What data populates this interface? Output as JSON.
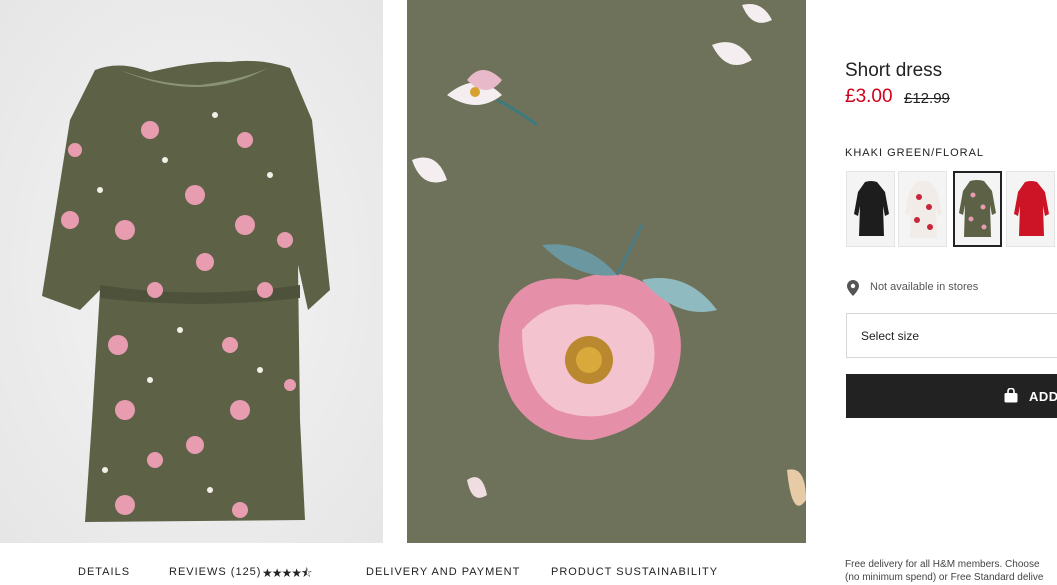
{
  "product": {
    "title": "Short dress",
    "price_now": "£3.00",
    "price_old": "£12.99",
    "color_name": "KHAKI GREEN/FLORAL"
  },
  "swatches": [
    {
      "name": "black",
      "color": "#1d1d1d",
      "selected": false
    },
    {
      "name": "white-floral",
      "color": "#f2ece8",
      "selected": false
    },
    {
      "name": "khaki-floral",
      "color": "#5d6247",
      "selected": true
    },
    {
      "name": "red",
      "color": "#cc1426",
      "selected": false
    }
  ],
  "store": {
    "icon": "location-pin-icon",
    "text": "Not available in stores"
  },
  "size": {
    "label": "Select size"
  },
  "cart": {
    "icon": "shopping-bag-icon",
    "label": "ADD"
  },
  "tabs": {
    "details": "DETAILS",
    "reviews": "REVIEWS (125)",
    "stars": "★★★★⯪",
    "delivery": "DELIVERY AND PAYMENT",
    "sustainability": "PRODUCT SUSTAINABILITY"
  },
  "delivery_note": {
    "line1": "Free delivery for all H&M members. Choose",
    "line2": "(no minimum spend) or Free Standard delive"
  },
  "colors": {
    "dress": "#5d6247",
    "price_red": "#d0021b",
    "button_dark": "#222222"
  }
}
